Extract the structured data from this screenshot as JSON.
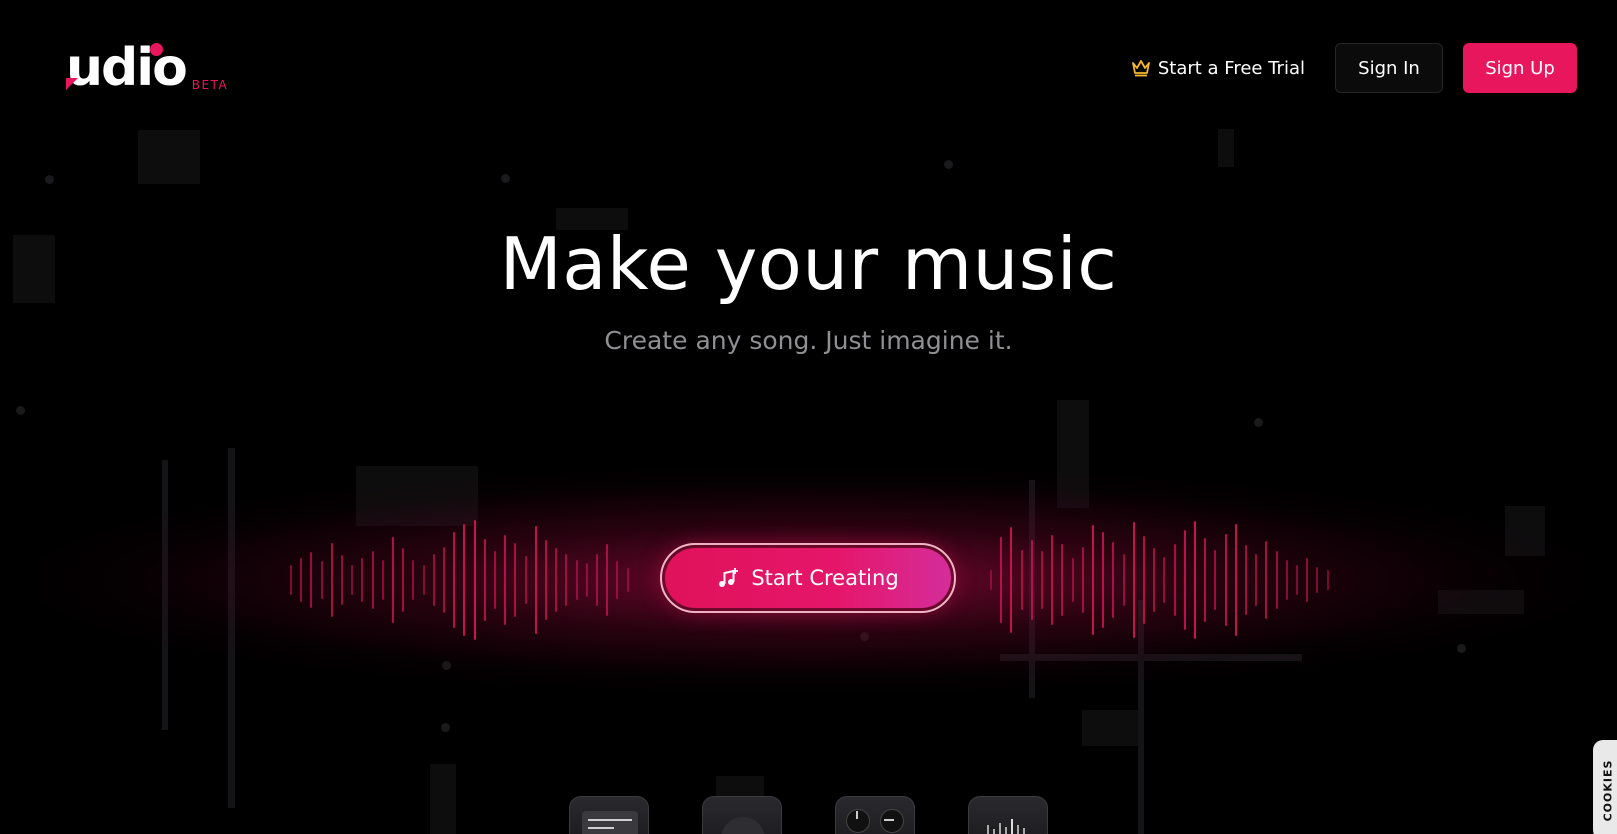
{
  "header": {
    "logo_text": "udio",
    "logo_badge": "BETA",
    "trial_label": "Start a Free Trial",
    "trial_icon": "crown-icon",
    "signin_label": "Sign In",
    "signup_label": "Sign Up"
  },
  "hero": {
    "title": "Make your music",
    "subtitle": "Create any song. Just imagine it.",
    "cta_label": "Start Creating",
    "cta_icon": "music-note-plus-icon"
  },
  "feature_cards": [
    {
      "icon": "lyrics-card-icon"
    },
    {
      "icon": "disc-card-icon"
    },
    {
      "icon": "knobs-card-icon"
    },
    {
      "icon": "waveform-card-icon"
    }
  ],
  "cookie_tab": {
    "label": "COOKIES"
  },
  "colors": {
    "accent": "#e8175d",
    "background": "#000000",
    "subtitle": "#8f8f94",
    "trial_icon": "#f5b82e"
  }
}
